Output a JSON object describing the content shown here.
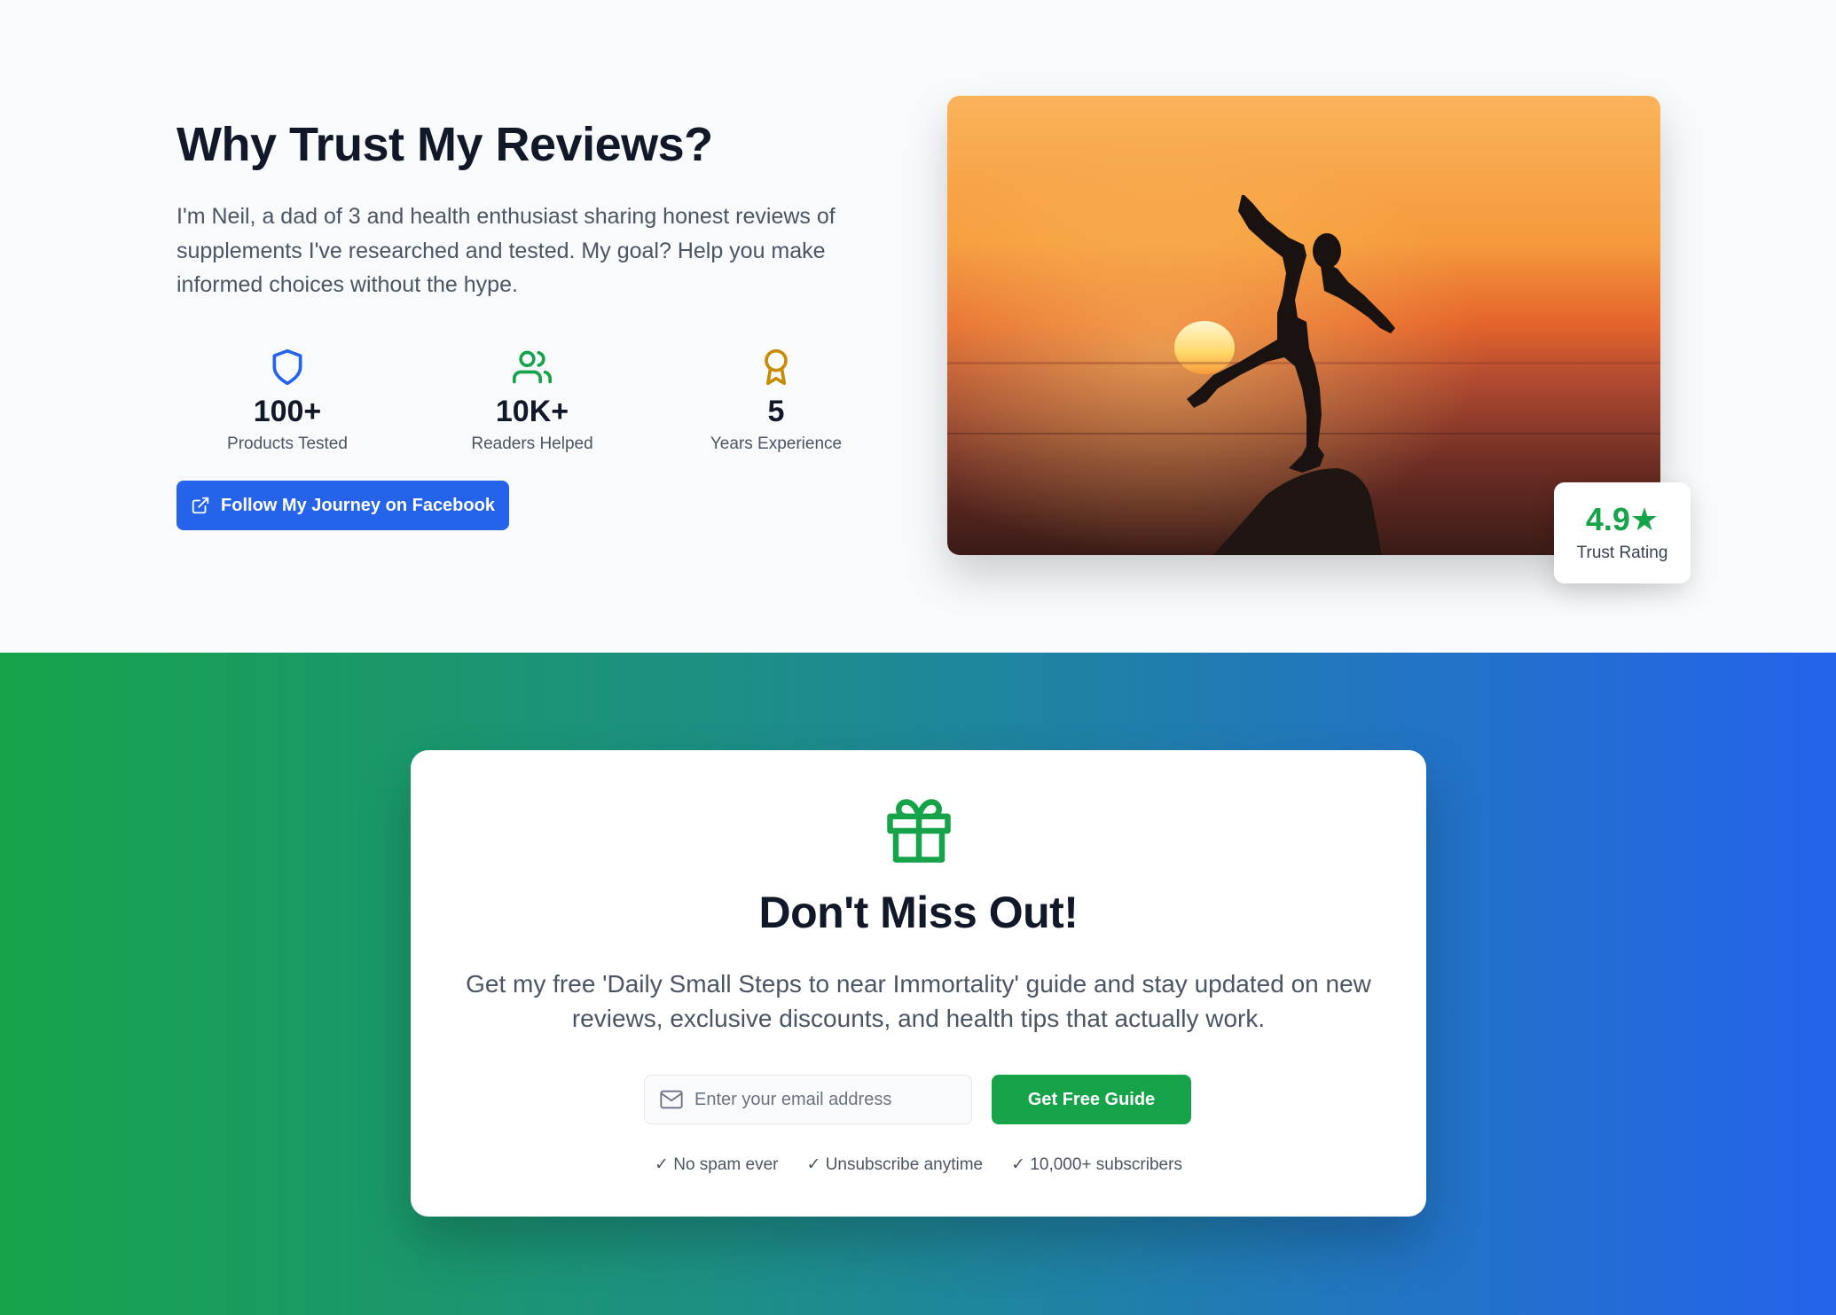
{
  "trust": {
    "title": "Why Trust My Reviews?",
    "description": "I'm Neil, a dad of 3 and health enthusiast sharing honest reviews of supplements I've researched and tested. My goal? Help you make informed choices without the hype.",
    "stats": [
      {
        "icon": "shield-icon",
        "value": "100+",
        "label": "Products Tested",
        "color": "#2563eb"
      },
      {
        "icon": "users-icon",
        "value": "10K+",
        "label": "Readers Helped",
        "color": "#16a34a"
      },
      {
        "icon": "award-icon",
        "value": "5",
        "label": "Years Experience",
        "color": "#ca8a04"
      }
    ],
    "facebook_button": {
      "icon": "external-link-icon",
      "label": "Follow My Journey on Facebook"
    },
    "rating": {
      "value": "4.9★",
      "label": "Trust Rating"
    }
  },
  "newsletter": {
    "icon": "gift-icon",
    "title": "Don't Miss Out!",
    "description": "Get my free 'Daily Small Steps to near Immortality' guide and stay updated on new reviews, exclusive discounts, and health tips that actually work.",
    "email_placeholder": "Enter your email address",
    "email_value": "",
    "submit_label": "Get Free Guide",
    "perks": [
      "✓ No spam ever",
      "✓ Unsubscribe anytime",
      "✓ 10,000+ subscribers"
    ]
  },
  "colors": {
    "primary_blue": "#2563eb",
    "primary_green": "#16a34a",
    "award_gold": "#ca8a04",
    "text_dark": "#111827",
    "text_muted": "#4b5563"
  }
}
